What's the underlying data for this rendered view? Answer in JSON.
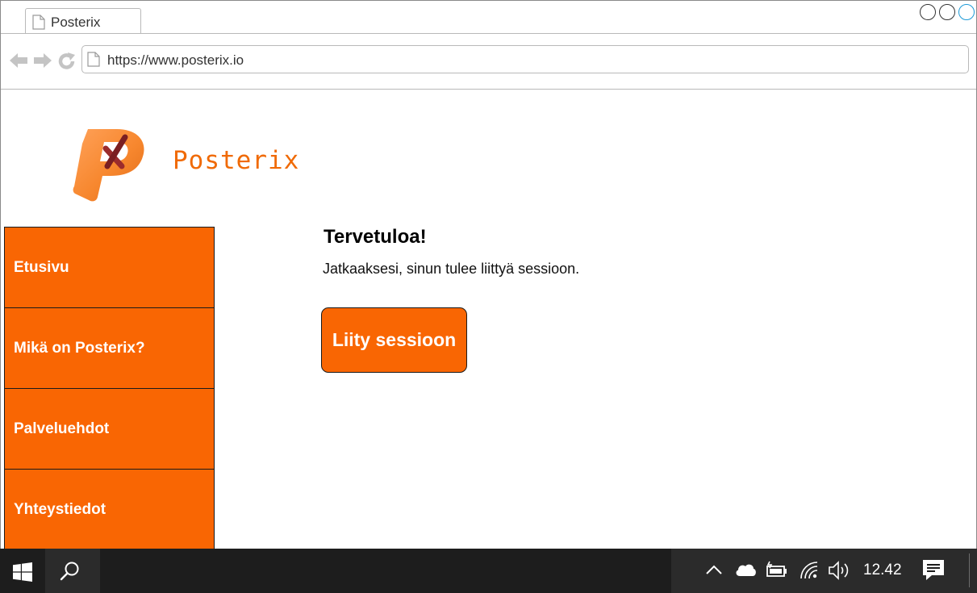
{
  "browser": {
    "tab_title": "Posterix",
    "url": "https://www.posterix.io"
  },
  "site": {
    "brand_name": "Posterix",
    "brand_color": "#f06a05",
    "accent_color": "#f96603"
  },
  "sidebar": {
    "items": [
      {
        "label": "Etusivu"
      },
      {
        "label": "Mikä on Posterix?"
      },
      {
        "label": "Palveluehdot"
      },
      {
        "label": "Yhteystiedot"
      }
    ]
  },
  "main": {
    "title": "Tervetuloa!",
    "text": "Jatkaaksesi, sinun tulee liittyä sessioon.",
    "join_button": "Liity sessioon"
  },
  "taskbar": {
    "clock": "12.42",
    "icons": [
      "windows-start-icon",
      "search-icon",
      "chevron-up-icon",
      "cloud-icon",
      "battery-icon",
      "wifi-icon",
      "volume-icon",
      "notifications-icon"
    ]
  }
}
